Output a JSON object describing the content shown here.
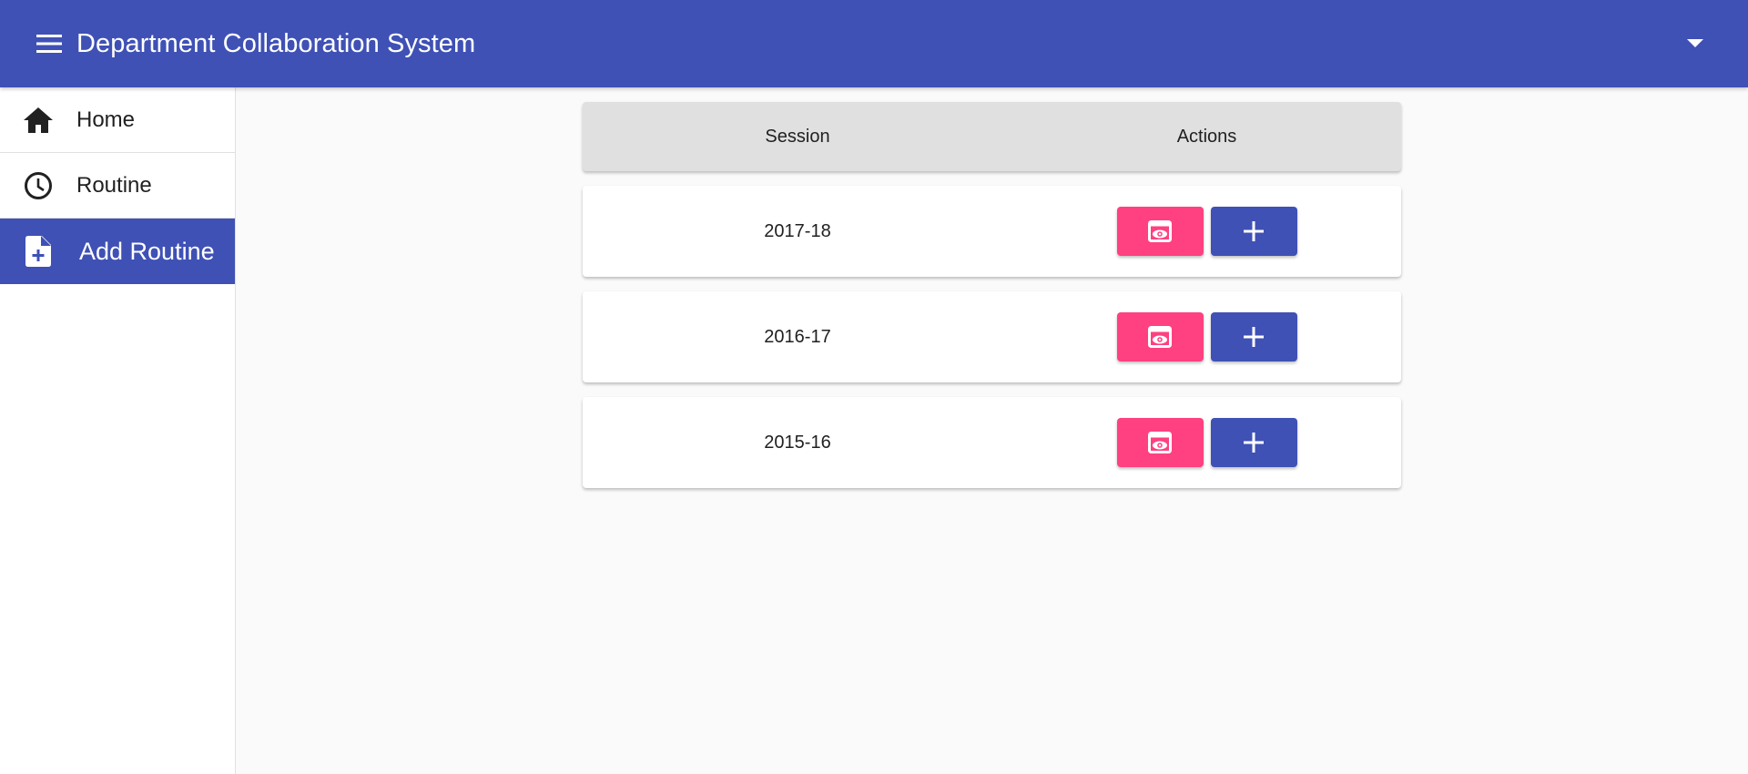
{
  "app": {
    "title": "Department Collaboration System",
    "primary_color": "#3f51b5",
    "accent_color": "#ff4081"
  },
  "header": {
    "menu_icon": "menu-icon",
    "account_icon": "arrow-drop-down-icon"
  },
  "sidebar": {
    "items": [
      {
        "label": "Home",
        "icon": "home-icon",
        "active": false
      },
      {
        "label": "Routine",
        "icon": "clock-icon",
        "active": false
      },
      {
        "label": "Add Routine",
        "icon": "note-add-icon",
        "active": true
      }
    ]
  },
  "table": {
    "columns": [
      "Session",
      "Actions"
    ],
    "rows": [
      {
        "session": "2017-18",
        "actions": [
          "view-icon",
          "add-icon"
        ]
      },
      {
        "session": "2016-17",
        "actions": [
          "view-icon",
          "add-icon"
        ]
      },
      {
        "session": "2015-16",
        "actions": [
          "view-icon",
          "add-icon"
        ]
      }
    ]
  }
}
